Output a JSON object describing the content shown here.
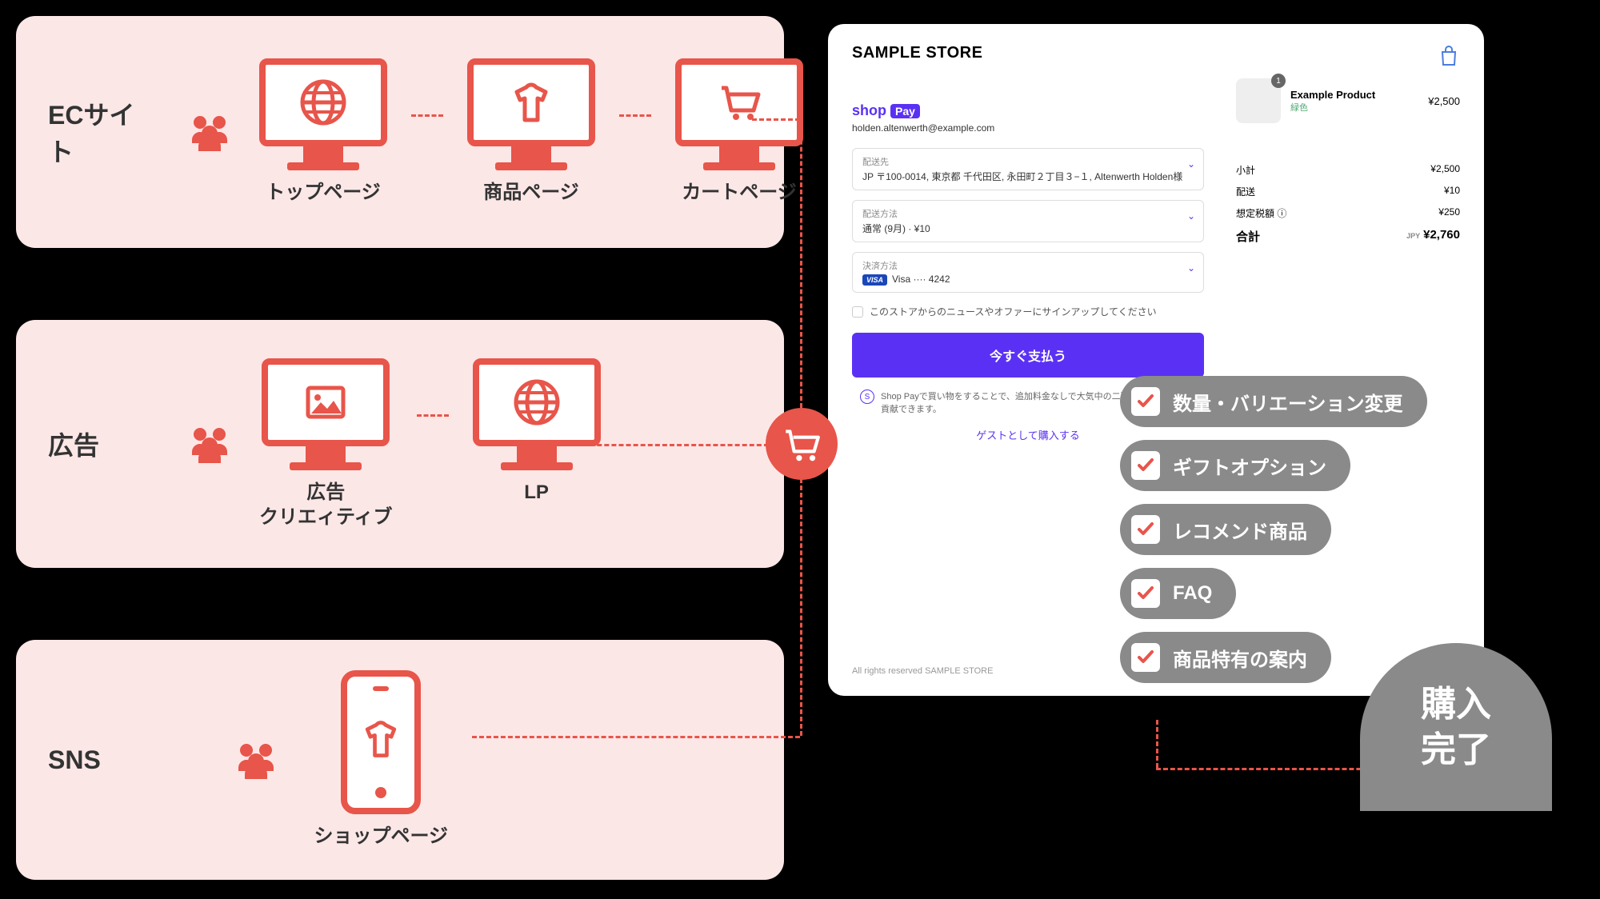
{
  "panels": {
    "ec": {
      "title": "ECサイト",
      "devices": [
        {
          "label": "トップページ",
          "icon": "globe"
        },
        {
          "label": "商品ページ",
          "icon": "shirt"
        },
        {
          "label": "カートページ",
          "icon": "cart"
        }
      ]
    },
    "ad": {
      "title": "広告",
      "devices": [
        {
          "label": "広告\nクリエィティブ",
          "icon": "image"
        },
        {
          "label": "LP",
          "icon": "globe"
        }
      ]
    },
    "sns": {
      "title": "SNS",
      "devices": [
        {
          "label": "ショップページ",
          "icon": "shirt"
        }
      ]
    }
  },
  "checkout": {
    "store": "SAMPLE STORE",
    "shop_pay": "shop",
    "shop_pay_pill": "Pay",
    "email": "holden.altenwerth@example.com",
    "shipping_label": "配送先",
    "shipping_value": "JP 〒100-0014, 東京都 千代田区, 永田町２丁目３−１, Altenwerth Holden様",
    "method_label": "配送方法",
    "method_value": "通常 (9月) · ¥10",
    "payment_label": "決済方法",
    "payment_value": "Visa ···· 4242",
    "signup": "このストアからのニュースやオファーにサインアップしてください",
    "pay_button": "今すぐ支払う",
    "sp_note": "Shop Payで買い物をすることで、追加料金なしで大気中の二酸化炭素の除去に貢献できます。",
    "guest": "ゲストとして購入する",
    "footer": "All rights reserved SAMPLE STORE",
    "product": {
      "name": "Example Product",
      "variant": "緑色",
      "price": "¥2,500",
      "qty": "1"
    },
    "summary": {
      "subtotal_label": "小計",
      "subtotal": "¥2,500",
      "shipping_label": "配送",
      "shipping": "¥10",
      "tax_label": "想定税額 ⓘ",
      "tax": "¥250",
      "total_label": "合計",
      "currency": "JPY",
      "total": "¥2,760"
    }
  },
  "features": [
    "数量・バリエーション変更",
    "ギフトオプション",
    "レコメンド商品",
    "FAQ",
    "商品特有の案内"
  ],
  "done": "購入\n完了"
}
